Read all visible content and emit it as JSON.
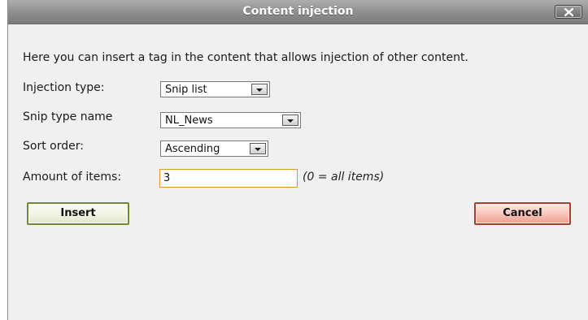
{
  "dialog": {
    "title": "Content injection",
    "close_icon": "close-icon",
    "description": "Here you can insert a tag in the content that allows injection of other content."
  },
  "form": {
    "injection_type": {
      "label": "Injection type:",
      "value": "Snip list"
    },
    "snip_type_name": {
      "label": "Snip type name",
      "value": "NL_News"
    },
    "sort_order": {
      "label": "Sort order:",
      "value": "Ascending"
    },
    "amount_of_items": {
      "label": "Amount of items:",
      "value": "3",
      "hint": "(0 = all items)"
    }
  },
  "buttons": {
    "insert_label": "Insert",
    "cancel_label": "Cancel"
  },
  "colors": {
    "titlebar": "#8f8f8f",
    "dialog_bg": "#f0f0f0",
    "insert_border": "#6d8a36",
    "cancel_border": "#a6402c",
    "input_focus_border": "#d79a2a"
  }
}
